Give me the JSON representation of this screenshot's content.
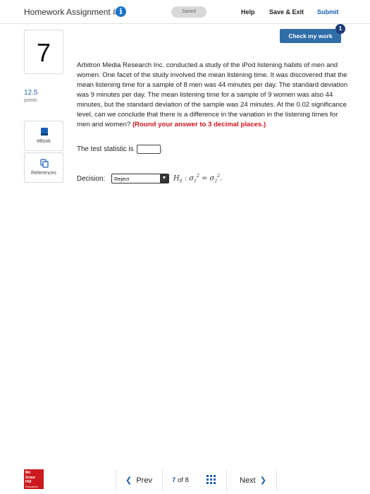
{
  "header": {
    "title": "Homework Assignment #4",
    "info_glyph": "i",
    "saved_label": "Saved",
    "help_label": "Help",
    "save_exit_label": "Save & Exit",
    "submit_label": "Submit"
  },
  "check_work": {
    "label": "Check my work",
    "badge": "1"
  },
  "question_panel": {
    "number": "7",
    "points_value": "12.5",
    "points_label": "points",
    "ebook_label": "eBook",
    "references_label": "References"
  },
  "question": {
    "text": "Arbitron Media Research Inc. conducted a study of the iPod listening habits of men and women. One facet of the study involved the mean listening time. It was discovered that the mean listening time for a sample of 8 men was 44 minutes per day. The standard deviation was 9 minutes per day. The mean listening time for a sample of 9 women was also 44 minutes, but the standard deviation of the sample was 24 minutes. At the 0.02 significance level, can we conclude that there is a difference in the variation in the listening times for men and women?",
    "emphasis": "(Round your answer to 3 decimal places.)",
    "stat_prefix": "The test statistic is",
    "stat_suffix": ".",
    "stat_value": "",
    "decision_label": "Decision:",
    "decision_value": "Reject",
    "hypothesis_text": "."
  },
  "footer": {
    "logo_line1": "Mc",
    "logo_line2": "Graw",
    "logo_line3": "Hill",
    "logo_line4": "Education",
    "prev_label": "Prev",
    "page_current": "7",
    "page_of": "of",
    "page_total": "8",
    "next_label": "Next"
  },
  "colors": {
    "accent": "#1a5fb4",
    "check_button": "#2f6ea8",
    "emphasis": "#d0121b",
    "logo": "#cc1a1f"
  },
  "icons": {
    "info": "info-icon",
    "ebook": "book-icon",
    "references": "copy-icon",
    "prev": "chevron-left-icon",
    "next": "chevron-right-icon",
    "grid": "grid-icon"
  }
}
